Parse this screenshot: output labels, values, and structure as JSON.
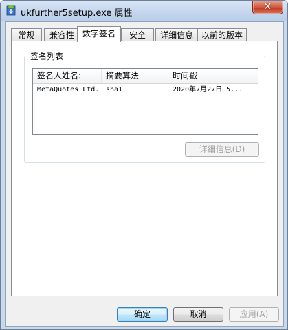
{
  "window": {
    "title": "ukfurther5setup.exe 属性",
    "close_symbol": "✕",
    "icon": "installer-icon"
  },
  "tabs": [
    {
      "label": "常规",
      "active": false
    },
    {
      "label": "兼容性",
      "active": false
    },
    {
      "label": "数字签名",
      "active": true
    },
    {
      "label": "安全",
      "active": false
    },
    {
      "label": "详细信息",
      "active": false
    },
    {
      "label": "以前的版本",
      "active": false
    }
  ],
  "signature_group": {
    "label": "签名列表",
    "columns": [
      "签名人姓名:",
      "摘要算法",
      "时间戳"
    ],
    "rows": [
      [
        "MetaQuotes Ltd.",
        "sha1",
        "2020年7月27日 5..."
      ]
    ],
    "details_button": "详细信息(D)"
  },
  "footer": {
    "ok_label": "确定",
    "cancel_label": "取消",
    "apply_label": "应用(A)"
  },
  "colors": {
    "title_bar": "#c6d7ee",
    "close_button": "#c94a2f",
    "default_button": "#3c7fb1"
  }
}
